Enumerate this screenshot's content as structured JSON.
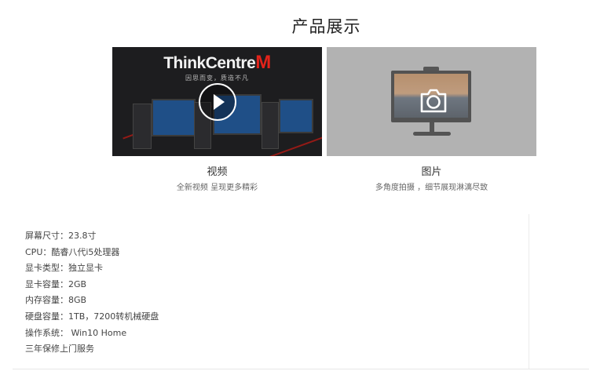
{
  "section": {
    "title": "产品展示"
  },
  "video": {
    "brand_main": "ThinkCentre",
    "brand_m": "M",
    "slogan": "因思而变，质造不凡",
    "caption_title": "视频",
    "caption_sub": "全新视频 呈现更多精彩"
  },
  "photo": {
    "caption_title": "图片",
    "caption_sub": "多角度拍摄 ，细节展现淋漓尽致"
  },
  "specs": [
    "屏幕尺寸：23.8寸",
    "CPU：酷睿八代i5处理器",
    "显卡类型：独立显卡",
    "显卡容量：2GB",
    "内存容量：8GB",
    "硬盘容量：1TB，7200转机械硬盘",
    "操作系统： Win10 Home",
    "三年保修上门服务"
  ],
  "icons": {
    "play": "play-icon",
    "camera": "camera-icon"
  },
  "colors": {
    "accent_red": "#e2231a",
    "video_bg": "#1d1d1f",
    "photo_bg": "#c8c8c8"
  }
}
